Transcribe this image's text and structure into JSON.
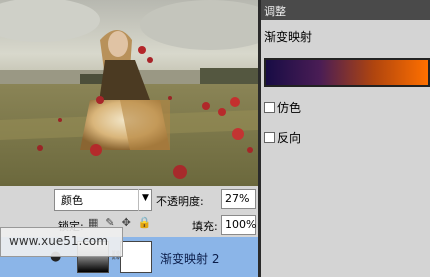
{
  "adjustments_panel": {
    "tab_label": "调整",
    "title": "渐变映射",
    "gradient_colors": [
      "#180c45",
      "#4a1d55",
      "#b0450e",
      "#ff7000"
    ],
    "dither_label": "仿色",
    "dither_checked": false,
    "reverse_label": "反向",
    "reverse_checked": false
  },
  "layers_panel": {
    "blend_mode": "颜色",
    "opacity_label": "不透明度:",
    "opacity_value": "27%",
    "lock_label": "锁定:",
    "fill_label": "填充:",
    "fill_value": "100%",
    "layer_name": "渐变映射 2"
  },
  "watermark": "www.xue51.com"
}
